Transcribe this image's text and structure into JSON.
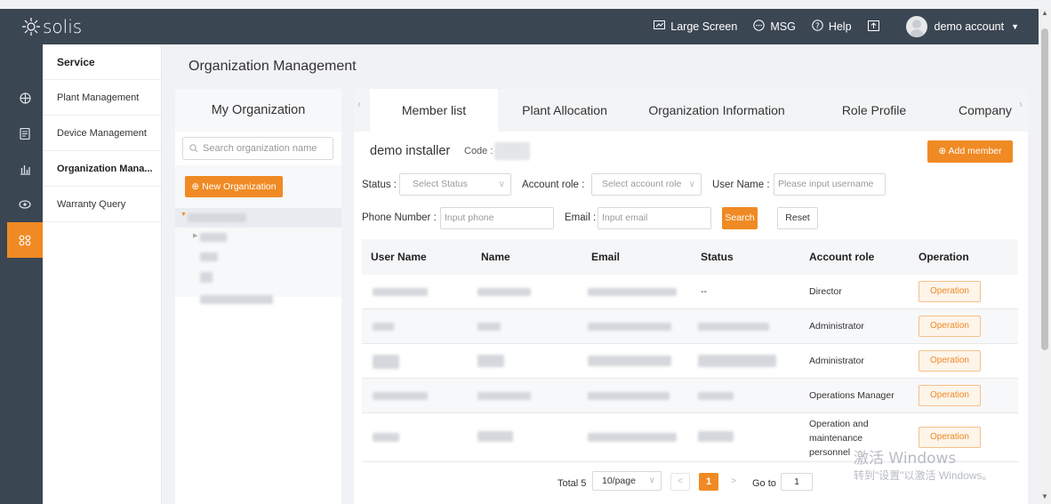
{
  "topbar": {
    "logo": "solis",
    "nav": [
      {
        "icon": "monitor-icon",
        "label": "Large Screen"
      },
      {
        "icon": "chat-icon",
        "label": "MSG"
      },
      {
        "icon": "help-icon",
        "label": "Help"
      },
      {
        "icon": "export-icon",
        "label": ""
      }
    ],
    "account": "demo account"
  },
  "iconbar": [
    "globe-icon",
    "document-icon",
    "chart-icon",
    "eye-icon",
    "apps-icon"
  ],
  "sidebar": {
    "header": "Service",
    "items": [
      {
        "label": "Plant Management"
      },
      {
        "label": "Device Management"
      },
      {
        "label": "Organization Mana..."
      },
      {
        "label": "Warranty Query"
      }
    ]
  },
  "page": {
    "title": "Organization Management"
  },
  "org_panel": {
    "title": "My Organization",
    "search_placeholder": "Search organization name",
    "new_button": "⊕ New Organization"
  },
  "tabs": [
    "Member list",
    "Plant Allocation",
    "Organization Information",
    "Role Profile",
    "Company"
  ],
  "member": {
    "company": "demo installer",
    "code_label": "Code :",
    "add_button": "⊕ Add member",
    "filters": {
      "status_label": "Status :",
      "status_placeholder": "Select Status",
      "role_label": "Account role :",
      "role_placeholder": "Select account role",
      "username_label": "User Name :",
      "username_placeholder": "Please input username",
      "phone_label": "Phone Number :",
      "phone_placeholder": "Input phone",
      "email_label": "Email :",
      "email_placeholder": "Input email",
      "search_button": "Search",
      "reset_button": "Reset"
    },
    "table": {
      "columns": [
        "User Name",
        "Name",
        "Email",
        "Status",
        "Account role",
        "Operation"
      ],
      "rows": [
        {
          "status": "--",
          "role": [
            "Director"
          ],
          "op": "Operation"
        },
        {
          "status": "",
          "role": [
            "Administrator"
          ],
          "op": "Operation"
        },
        {
          "status": "",
          "role": [
            "Administrator"
          ],
          "op": "Operation"
        },
        {
          "status": "",
          "role": [
            "Operations Manager"
          ],
          "op": "Operation"
        },
        {
          "status": "",
          "role": [
            "Operation and",
            "maintenance",
            "personnel"
          ],
          "op": "Operation"
        }
      ]
    },
    "pagination": {
      "total": "Total 5",
      "page_size": "10/page",
      "current": "1",
      "goto_label": "Go to",
      "goto_value": "1"
    }
  },
  "watermark": {
    "line1": "激活 Windows",
    "line2": "转到\"设置\"以激活 Windows。"
  }
}
